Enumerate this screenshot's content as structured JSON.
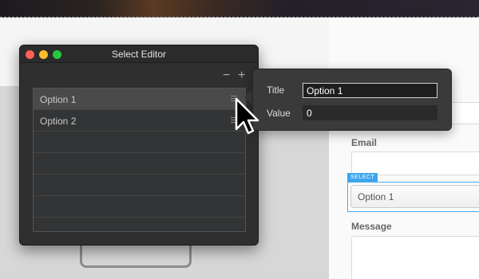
{
  "editor": {
    "title": "Select Editor",
    "toolbar": {
      "remove_label": "−",
      "add_label": "+"
    },
    "options": [
      {
        "label": "Option 1",
        "selected": true
      },
      {
        "label": "Option 2",
        "selected": false
      },
      {
        "label": ""
      },
      {
        "label": ""
      },
      {
        "label": ""
      },
      {
        "label": ""
      }
    ],
    "traffic_lights": {
      "close": "#ff5f57",
      "minimize": "#febc2e",
      "zoom": "#28c840"
    }
  },
  "popover": {
    "title_label": "Title",
    "title_value": "Option 1",
    "value_label": "Value",
    "value_value": "0"
  },
  "form": {
    "email_label": "Email",
    "select_tag": "SELECT",
    "select_value": "Option 1",
    "message_label": "Message"
  },
  "icons": {
    "cursor": "arrow-cursor-icon",
    "grip": "drag-handle-icon"
  },
  "colors": {
    "accent": "#3ea6ef",
    "window_bg": "#2f2f30",
    "selected_row": "#4a4a4b"
  }
}
